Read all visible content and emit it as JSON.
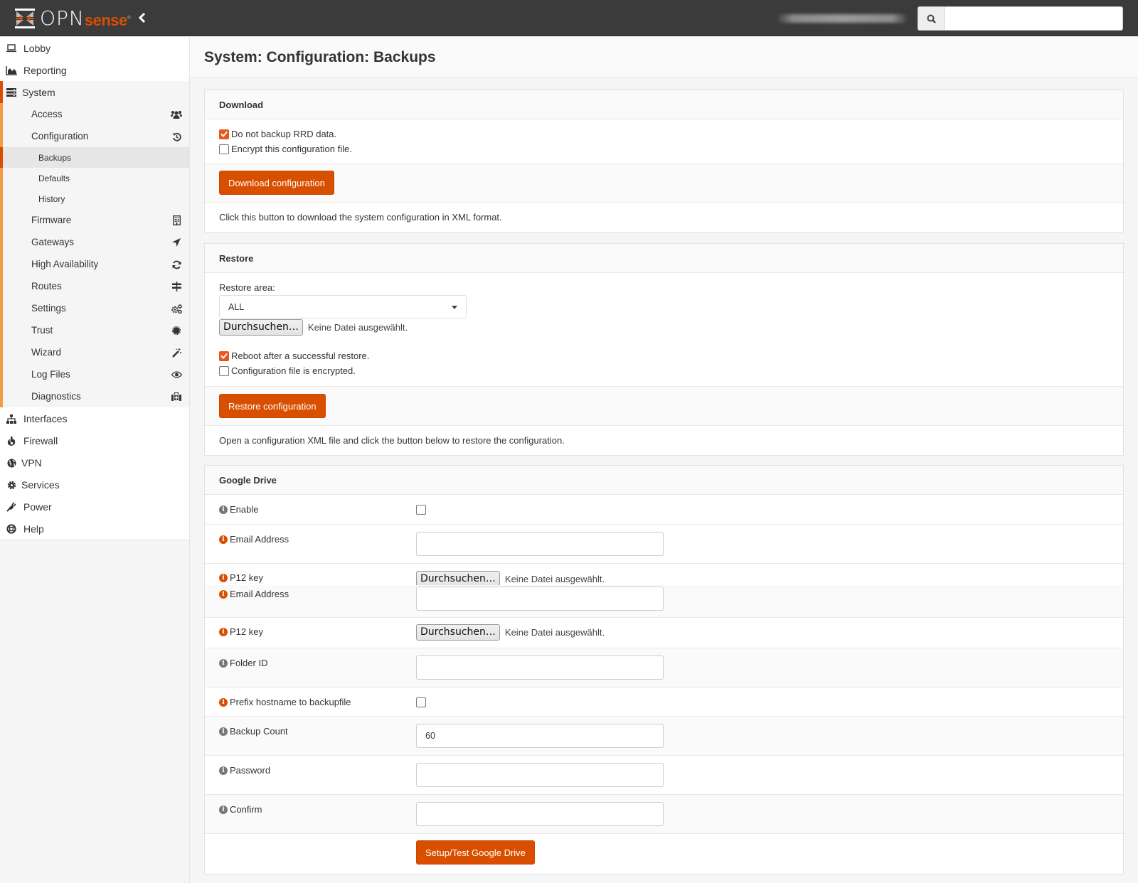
{
  "navbar": {
    "brand_opn": "OPN",
    "brand_sense": "sense",
    "brand_reg": "®",
    "collapse_icon": "chevron-left-icon",
    "search_placeholder": "",
    "search_icon": "search-icon"
  },
  "sidebar": {
    "top_items": [
      {
        "label": "Lobby",
        "icon": "laptop-icon"
      },
      {
        "label": "Reporting",
        "icon": "area-chart-icon"
      }
    ],
    "system": {
      "label": "System",
      "icon": "server-icon",
      "children": [
        {
          "label": "Access",
          "icon": "users-icon"
        },
        {
          "label": "Configuration",
          "icon": "history-icon",
          "children": [
            {
              "label": "Backups",
              "active": true
            },
            {
              "label": "Defaults"
            },
            {
              "label": "History"
            }
          ]
        },
        {
          "label": "Firmware",
          "icon": "building-icon"
        },
        {
          "label": "Gateways",
          "icon": "location-arrow-icon"
        },
        {
          "label": "High Availability",
          "icon": "refresh-icon"
        },
        {
          "label": "Routes",
          "icon": "map-signs-icon"
        },
        {
          "label": "Settings",
          "icon": "cogs-icon"
        },
        {
          "label": "Trust",
          "icon": "certificate-icon"
        },
        {
          "label": "Wizard",
          "icon": "magic-icon"
        },
        {
          "label": "Log Files",
          "icon": "eye-icon"
        },
        {
          "label": "Diagnostics",
          "icon": "medkit-icon"
        }
      ]
    },
    "bottom_items": [
      {
        "label": "Interfaces",
        "icon": "sitemap-icon"
      },
      {
        "label": "Firewall",
        "icon": "fire-icon"
      },
      {
        "label": "VPN",
        "icon": "globe-icon"
      },
      {
        "label": "Services",
        "icon": "cog-icon"
      },
      {
        "label": "Power",
        "icon": "plug-icon"
      },
      {
        "label": "Help",
        "icon": "life-ring-icon"
      }
    ]
  },
  "page": {
    "title": "System: Configuration: Backups"
  },
  "download": {
    "title": "Download",
    "no_rrd_label": "Do not backup RRD data.",
    "no_rrd_checked": true,
    "encrypt_label": "Encrypt this configuration file.",
    "encrypt_checked": false,
    "button": "Download configuration",
    "hint": "Click this button to download the system configuration in XML format."
  },
  "restore": {
    "title": "Restore",
    "area_label": "Restore area:",
    "area_value": "ALL",
    "file_button": "Durchsuchen…",
    "file_status": "Keine Datei ausgewählt.",
    "reboot_label": "Reboot after a successful restore.",
    "reboot_checked": true,
    "encrypted_label": "Configuration file is encrypted.",
    "encrypted_checked": false,
    "button": "Restore configuration",
    "hint": "Open a configuration XML file and click the button below to restore the configuration."
  },
  "gdrive": {
    "title": "Google Drive",
    "enable_label": "Enable",
    "enable_checked": false,
    "email_label": "Email Address",
    "email_value": "",
    "p12_label": "P12 key",
    "p12_button": "Durchsuchen…",
    "p12_status": "Keine Datei ausgewählt.",
    "folder_label": "Folder ID",
    "folder_value": "",
    "prefix_label": "Prefix hostname to backupfile",
    "prefix_checked": false,
    "count_label": "Backup Count",
    "count_value": "60",
    "password_label": "Password",
    "password_value": "",
    "confirm_label": "Confirm",
    "confirm_value": "",
    "button": "Setup/Test Google Drive"
  },
  "colors": {
    "accent": "#d94f00",
    "accent_light": "#f39c4a",
    "navbar": "#3b3b3b"
  }
}
